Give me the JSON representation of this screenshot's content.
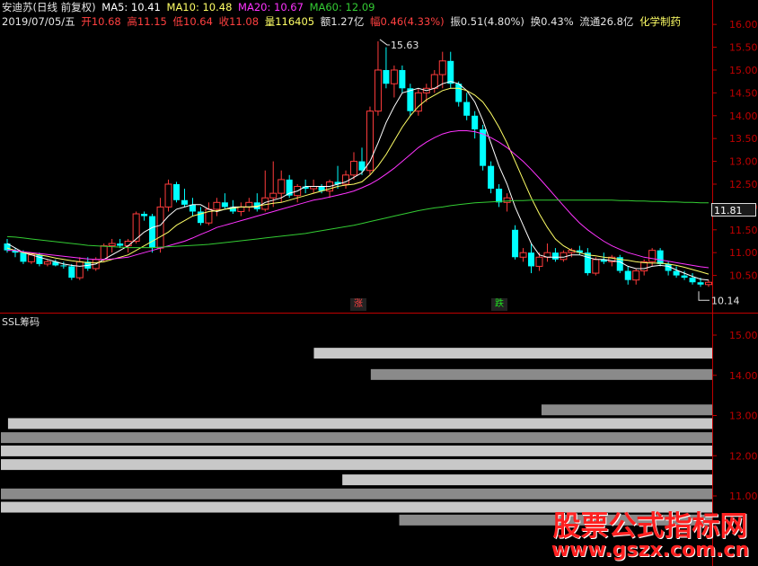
{
  "header": {
    "stock_name": "安迪苏(日线 前复权)",
    "ma5": "MA5: 10.41",
    "ma10": "MA10: 10.48",
    "ma20": "MA20: 10.67",
    "ma60": "MA60: 12.09",
    "date": "2019/07/05/五",
    "open": "开10.68",
    "high": "高11.15",
    "low": "低10.64",
    "close": "收11.08",
    "volume": "量116405",
    "amount": "额1.27亿",
    "change_pct": "幅0.46(4.33%)",
    "amplitude": "振0.51(4.80%)",
    "turnover": "换0.43%",
    "float_cap": "流通26.8亿",
    "sector": "化学制药"
  },
  "colors": {
    "up": "#ff3c3c",
    "down": "#00ffff",
    "ma5": "#ffffff",
    "ma10": "#ffff66",
    "ma20": "#ff33ff",
    "ma60": "#33cc33",
    "axis": "#c00000",
    "bar_light": "#c8c8c8",
    "bar_dark": "#8a8a8a"
  },
  "price_axis": {
    "min": 10.0,
    "max": 16.2,
    "ticks": [
      "16.00",
      "15.50",
      "15.00",
      "14.50",
      "14.00",
      "13.50",
      "13.00",
      "12.50",
      "12.00",
      "11.50",
      "11.00",
      "10.50"
    ],
    "current_level": "11.81"
  },
  "annotations": {
    "high_label": "15.63",
    "low_label": "10.14",
    "up_mark": "涨",
    "down_mark": "跌"
  },
  "indicator": {
    "title": "SSL筹码",
    "axis_ticks": [
      "15.00",
      "14.00",
      "13.00",
      "12.00",
      "11.00"
    ],
    "axis_min": 10.4,
    "axis_max": 15.4
  },
  "chart_data": [
    {
      "type": "candlestick",
      "title": "安迪苏(日线 前复权)",
      "ylim": [
        10.0,
        16.2
      ],
      "candles": [
        [
          11.2,
          11.3,
          11.0,
          11.05
        ],
        [
          11.05,
          11.1,
          10.9,
          11.0
        ],
        [
          11.0,
          11.05,
          10.75,
          10.8
        ],
        [
          10.8,
          11.0,
          10.75,
          10.95
        ],
        [
          10.95,
          11.0,
          10.7,
          10.75
        ],
        [
          10.75,
          10.85,
          10.7,
          10.8
        ],
        [
          10.8,
          10.85,
          10.7,
          10.72
        ],
        [
          10.72,
          10.8,
          10.65,
          10.7
        ],
        [
          10.7,
          10.75,
          10.4,
          10.45
        ],
        [
          10.45,
          10.9,
          10.4,
          10.8
        ],
        [
          10.8,
          10.9,
          10.6,
          10.65
        ],
        [
          10.65,
          10.9,
          10.6,
          10.85
        ],
        [
          10.85,
          11.2,
          10.8,
          11.15
        ],
        [
          11.15,
          11.3,
          11.0,
          11.2
        ],
        [
          11.2,
          11.3,
          11.1,
          11.15
        ],
        [
          11.15,
          11.3,
          11.0,
          11.25
        ],
        [
          11.25,
          11.9,
          11.2,
          11.85
        ],
        [
          11.85,
          11.9,
          11.7,
          11.8
        ],
        [
          11.8,
          11.85,
          11.0,
          11.1
        ],
        [
          11.1,
          12.2,
          11.0,
          12.0
        ],
        [
          12.0,
          12.6,
          11.9,
          12.5
        ],
        [
          12.5,
          12.55,
          12.1,
          12.15
        ],
        [
          12.15,
          12.4,
          12.0,
          12.05
        ],
        [
          12.05,
          12.2,
          11.8,
          11.9
        ],
        [
          11.9,
          12.0,
          11.6,
          11.65
        ],
        [
          11.65,
          12.1,
          11.6,
          11.95
        ],
        [
          11.95,
          12.2,
          11.8,
          12.1
        ],
        [
          12.1,
          12.3,
          11.95,
          12.0
        ],
        [
          12.0,
          12.15,
          11.85,
          11.9
        ],
        [
          11.9,
          12.1,
          11.8,
          12.0
        ],
        [
          12.0,
          12.2,
          11.9,
          12.1
        ],
        [
          12.1,
          12.3,
          11.9,
          11.95
        ],
        [
          11.95,
          12.8,
          11.9,
          12.2
        ],
        [
          12.2,
          13.0,
          12.0,
          12.3
        ],
        [
          12.3,
          12.8,
          12.1,
          12.6
        ],
        [
          12.6,
          12.7,
          12.2,
          12.25
        ],
        [
          12.25,
          12.5,
          12.1,
          12.45
        ],
        [
          12.45,
          12.6,
          12.3,
          12.4
        ],
        [
          12.4,
          12.6,
          12.3,
          12.45
        ],
        [
          12.45,
          12.5,
          12.3,
          12.35
        ],
        [
          12.35,
          12.6,
          12.2,
          12.55
        ],
        [
          12.55,
          12.9,
          12.4,
          12.5
        ],
        [
          12.5,
          12.8,
          12.4,
          12.7
        ],
        [
          12.7,
          13.2,
          12.6,
          13.0
        ],
        [
          13.0,
          13.3,
          12.7,
          12.8
        ],
        [
          12.8,
          14.2,
          12.7,
          14.1
        ],
        [
          14.1,
          15.63,
          14.0,
          15.0
        ],
        [
          15.0,
          15.5,
          14.6,
          14.7
        ],
        [
          14.7,
          15.1,
          14.4,
          15.0
        ],
        [
          15.0,
          15.1,
          14.5,
          14.6
        ],
        [
          14.6,
          14.7,
          14.0,
          14.1
        ],
        [
          14.1,
          14.6,
          14.0,
          14.5
        ],
        [
          14.5,
          14.7,
          14.3,
          14.6
        ],
        [
          14.6,
          15.0,
          14.5,
          14.9
        ],
        [
          14.9,
          15.4,
          14.6,
          15.2
        ],
        [
          15.2,
          15.4,
          14.6,
          14.7
        ],
        [
          14.7,
          14.75,
          14.2,
          14.3
        ],
        [
          14.3,
          14.5,
          13.9,
          14.0
        ],
        [
          14.0,
          14.1,
          13.5,
          13.7
        ],
        [
          13.7,
          13.8,
          12.8,
          12.9
        ],
        [
          12.9,
          13.0,
          12.3,
          12.4
        ],
        [
          12.4,
          12.5,
          12.0,
          12.1
        ],
        [
          12.1,
          12.3,
          11.9,
          12.2
        ],
        [
          11.5,
          11.6,
          10.85,
          10.9
        ],
        [
          10.9,
          11.1,
          10.8,
          11.0
        ],
        [
          11.0,
          11.2,
          10.55,
          10.7
        ],
        [
          10.7,
          11.0,
          10.6,
          10.9
        ],
        [
          10.9,
          11.2,
          10.8,
          11.0
        ],
        [
          11.0,
          11.1,
          10.8,
          10.85
        ],
        [
          10.85,
          11.05,
          10.8,
          11.0
        ],
        [
          11.0,
          11.1,
          10.9,
          11.05
        ],
        [
          11.05,
          11.15,
          10.95,
          11.0
        ],
        [
          11.0,
          11.1,
          10.5,
          10.55
        ],
        [
          10.55,
          10.9,
          10.5,
          10.85
        ],
        [
          10.85,
          11.0,
          10.75,
          10.8
        ],
        [
          10.8,
          10.95,
          10.7,
          10.9
        ],
        [
          10.9,
          10.95,
          10.55,
          10.6
        ],
        [
          10.6,
          10.7,
          10.3,
          10.4
        ],
        [
          10.4,
          10.65,
          10.3,
          10.6
        ],
        [
          10.6,
          10.85,
          10.5,
          10.8
        ],
        [
          10.8,
          11.1,
          10.7,
          11.05
        ],
        [
          11.05,
          11.1,
          10.7,
          10.75
        ],
        [
          10.75,
          10.8,
          10.5,
          10.6
        ],
        [
          10.6,
          10.7,
          10.45,
          10.5
        ],
        [
          10.5,
          10.6,
          10.4,
          10.45
        ],
        [
          10.45,
          10.55,
          10.3,
          10.35
        ],
        [
          10.35,
          10.45,
          10.25,
          10.3
        ],
        [
          10.3,
          10.4,
          10.25,
          10.35
        ]
      ],
      "series": [
        {
          "name": "MA5",
          "values": [
            11.2,
            11.1,
            11.0,
            10.95,
            10.9,
            10.85,
            10.8,
            10.75,
            10.72,
            10.7,
            10.72,
            10.75,
            10.85,
            10.95,
            11.05,
            11.15,
            11.3,
            11.45,
            11.55,
            11.6,
            11.8,
            11.95,
            12.0,
            12.05,
            12.05,
            11.95,
            11.9,
            11.95,
            12.0,
            12.0,
            12.0,
            12.0,
            12.1,
            12.15,
            12.2,
            12.3,
            12.35,
            12.45,
            12.45,
            12.45,
            12.45,
            12.5,
            12.55,
            12.65,
            12.75,
            13.0,
            13.4,
            13.85,
            14.2,
            14.5,
            14.55,
            14.6,
            14.55,
            14.6,
            14.7,
            14.75,
            14.7,
            14.55,
            14.3,
            13.9,
            13.4,
            12.9,
            12.5,
            12.0,
            11.6,
            11.2,
            10.95,
            10.9,
            10.9,
            10.9,
            10.95,
            10.95,
            10.9,
            10.85,
            10.85,
            10.82,
            10.8,
            10.7,
            10.65,
            10.65,
            10.7,
            10.72,
            10.7,
            10.62,
            10.55,
            10.48,
            10.42,
            10.4
          ]
        },
        {
          "name": "MA10",
          "values": [
            11.1,
            11.05,
            11.0,
            10.98,
            10.95,
            10.92,
            10.88,
            10.85,
            10.82,
            10.8,
            10.78,
            10.78,
            10.8,
            10.85,
            10.9,
            10.95,
            11.05,
            11.15,
            11.25,
            11.35,
            11.45,
            11.6,
            11.7,
            11.8,
            11.85,
            11.9,
            11.92,
            11.95,
            11.97,
            12.0,
            12.0,
            12.02,
            12.05,
            12.08,
            12.1,
            12.15,
            12.2,
            12.25,
            12.3,
            12.35,
            12.4,
            12.45,
            12.48,
            12.5,
            12.55,
            12.7,
            12.9,
            13.15,
            13.45,
            13.75,
            14.0,
            14.2,
            14.35,
            14.45,
            14.55,
            14.6,
            14.6,
            14.55,
            14.45,
            14.3,
            14.05,
            13.75,
            13.4,
            13.0,
            12.6,
            12.2,
            11.85,
            11.55,
            11.3,
            11.15,
            11.05,
            11.0,
            10.95,
            10.93,
            10.9,
            10.88,
            10.85,
            10.83,
            10.8,
            10.78,
            10.77,
            10.77,
            10.75,
            10.72,
            10.68,
            10.63,
            10.58,
            10.53
          ]
        },
        {
          "name": "MA20",
          "values": [
            11.05,
            11.05,
            11.02,
            11.0,
            10.98,
            10.96,
            10.94,
            10.92,
            10.9,
            10.88,
            10.86,
            10.85,
            10.85,
            10.86,
            10.88,
            10.9,
            10.95,
            11.0,
            11.05,
            11.1,
            11.15,
            11.2,
            11.25,
            11.32,
            11.4,
            11.47,
            11.55,
            11.6,
            11.65,
            11.7,
            11.75,
            11.8,
            11.85,
            11.9,
            11.95,
            12.0,
            12.05,
            12.1,
            12.15,
            12.18,
            12.22,
            12.26,
            12.3,
            12.35,
            12.42,
            12.5,
            12.6,
            12.72,
            12.85,
            13.0,
            13.15,
            13.3,
            13.42,
            13.52,
            13.6,
            13.65,
            13.67,
            13.67,
            13.65,
            13.6,
            13.52,
            13.42,
            13.3,
            13.15,
            13.0,
            12.82,
            12.63,
            12.43,
            12.23,
            12.03,
            11.83,
            11.65,
            11.5,
            11.37,
            11.25,
            11.15,
            11.07,
            11.0,
            10.95,
            10.9,
            10.87,
            10.84,
            10.81,
            10.78,
            10.75,
            10.72,
            10.69,
            10.67
          ]
        },
        {
          "name": "MA60",
          "values": [
            11.35,
            11.34,
            11.32,
            11.3,
            11.28,
            11.26,
            11.24,
            11.22,
            11.2,
            11.18,
            11.16,
            11.15,
            11.14,
            11.13,
            11.12,
            11.11,
            11.11,
            11.11,
            11.11,
            11.12,
            11.13,
            11.14,
            11.15,
            11.16,
            11.17,
            11.18,
            11.2,
            11.22,
            11.24,
            11.26,
            11.28,
            11.3,
            11.32,
            11.34,
            11.36,
            11.38,
            11.4,
            11.42,
            11.45,
            11.48,
            11.51,
            11.54,
            11.57,
            11.6,
            11.64,
            11.68,
            11.72,
            11.76,
            11.8,
            11.84,
            11.88,
            11.92,
            11.95,
            11.98,
            12.0,
            12.03,
            12.05,
            12.07,
            12.09,
            12.1,
            12.11,
            12.12,
            12.13,
            12.14,
            12.14,
            12.15,
            12.15,
            12.15,
            12.15,
            12.15,
            12.15,
            12.15,
            12.15,
            12.15,
            12.15,
            12.15,
            12.14,
            12.14,
            12.13,
            12.13,
            12.12,
            12.12,
            12.11,
            12.11,
            12.1,
            12.1,
            12.09,
            12.09
          ]
        }
      ]
    },
    {
      "type": "bar",
      "title": "SSL筹码",
      "orientation": "horizontal",
      "ylim": [
        10.4,
        15.4
      ],
      "bars": [
        {
          "price": 14.55,
          "fraction": 0.56,
          "shade": "light"
        },
        {
          "price": 14.02,
          "fraction": 0.48,
          "shade": "dark"
        },
        {
          "price": 13.14,
          "fraction": 0.24,
          "shade": "dark"
        },
        {
          "price": 12.8,
          "fraction": 0.99,
          "shade": "light"
        },
        {
          "price": 12.45,
          "fraction": 1.0,
          "shade": "dark"
        },
        {
          "price": 12.12,
          "fraction": 1.0,
          "shade": "light"
        },
        {
          "price": 11.78,
          "fraction": 1.0,
          "shade": "light"
        },
        {
          "price": 11.4,
          "fraction": 0.52,
          "shade": "light"
        },
        {
          "price": 11.05,
          "fraction": 1.0,
          "shade": "dark"
        },
        {
          "price": 10.72,
          "fraction": 1.0,
          "shade": "light"
        },
        {
          "price": 10.4,
          "fraction": 0.44,
          "shade": "dark"
        }
      ]
    }
  ],
  "watermark": {
    "title": "股票公式指标网",
    "url": "www.gszx.com.cn"
  }
}
